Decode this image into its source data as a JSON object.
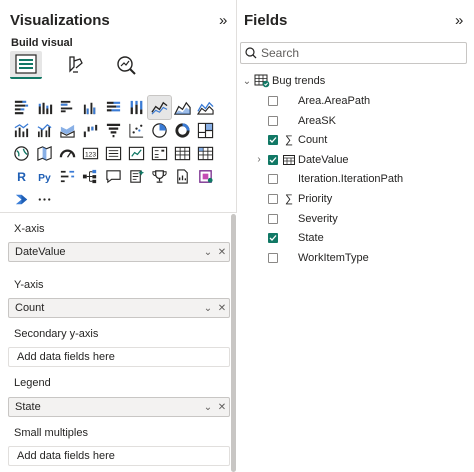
{
  "visualizations": {
    "title": "Visualizations",
    "collapse_icon": "double-chevron-right-icon",
    "build_label": "Build visual",
    "modes": [
      {
        "icon": "build-visual-icon",
        "active": true
      },
      {
        "icon": "format-visual-icon",
        "active": false
      },
      {
        "icon": "analytics-icon",
        "active": false
      }
    ],
    "visual_types": [
      "stacked-bar-chart-icon",
      "stacked-column-chart-icon",
      "clustered-bar-chart-icon",
      "clustered-column-chart-icon",
      "100-stacked-bar-chart-icon",
      "100-stacked-column-chart-icon",
      "line-chart-icon",
      "area-chart-icon",
      "stacked-area-chart-icon",
      "line-and-stacked-column-chart-icon",
      "line-and-clustered-column-chart-icon",
      "ribbon-chart-icon",
      "waterfall-chart-icon",
      "funnel-icon",
      "scatter-chart-icon",
      "pie-chart-icon",
      "donut-chart-icon",
      "treemap-icon",
      "map-icon",
      "filled-map-icon",
      "gauge-icon",
      "card-icon",
      "multi-row-card-icon",
      "kpi-icon",
      "slicer-icon",
      "table-icon",
      "matrix-icon",
      "r-visual-icon",
      "python-visual-icon",
      "key-influencers-icon",
      "decomposition-tree-icon",
      "qa-icon",
      "smart-narrative-icon",
      "metrics-icon",
      "paginated-report-icon",
      "power-apps-icon",
      "power-automate-icon",
      "more-visuals-icon"
    ],
    "selected_visual": "line-chart-icon",
    "more_label": "···",
    "wells": {
      "xaxis": {
        "title": "X-axis",
        "value": "DateValue"
      },
      "yaxis": {
        "title": "Y-axis",
        "value": "Count"
      },
      "secondary_y": {
        "title": "Secondary y-axis",
        "placeholder": "Add data fields here"
      },
      "legend": {
        "title": "Legend",
        "value": "State"
      },
      "small_multiples": {
        "title": "Small multiples",
        "placeholder": "Add data fields here"
      }
    }
  },
  "fields": {
    "title": "Fields",
    "collapse_icon": "double-chevron-right-icon",
    "search_placeholder": "Search",
    "table": {
      "name": "Bug trends",
      "icon": "table-icon",
      "expanded": true,
      "items": [
        {
          "label": "Area.AreaPath",
          "checked": false,
          "kind": "text"
        },
        {
          "label": "AreaSK",
          "checked": false,
          "kind": "text"
        },
        {
          "label": "Count",
          "checked": true,
          "kind": "sum"
        },
        {
          "label": "DateValue",
          "checked": true,
          "kind": "date"
        },
        {
          "label": "Iteration.IterationPath",
          "checked": false,
          "kind": "text"
        },
        {
          "label": "Priority",
          "checked": false,
          "kind": "sum"
        },
        {
          "label": "Severity",
          "checked": false,
          "kind": "text"
        },
        {
          "label": "State",
          "checked": true,
          "kind": "text"
        },
        {
          "label": "WorkItemType",
          "checked": false,
          "kind": "text"
        }
      ]
    }
  },
  "colors": {
    "accent": "#117865",
    "border": "#c8c6c4",
    "text": "#252423"
  }
}
